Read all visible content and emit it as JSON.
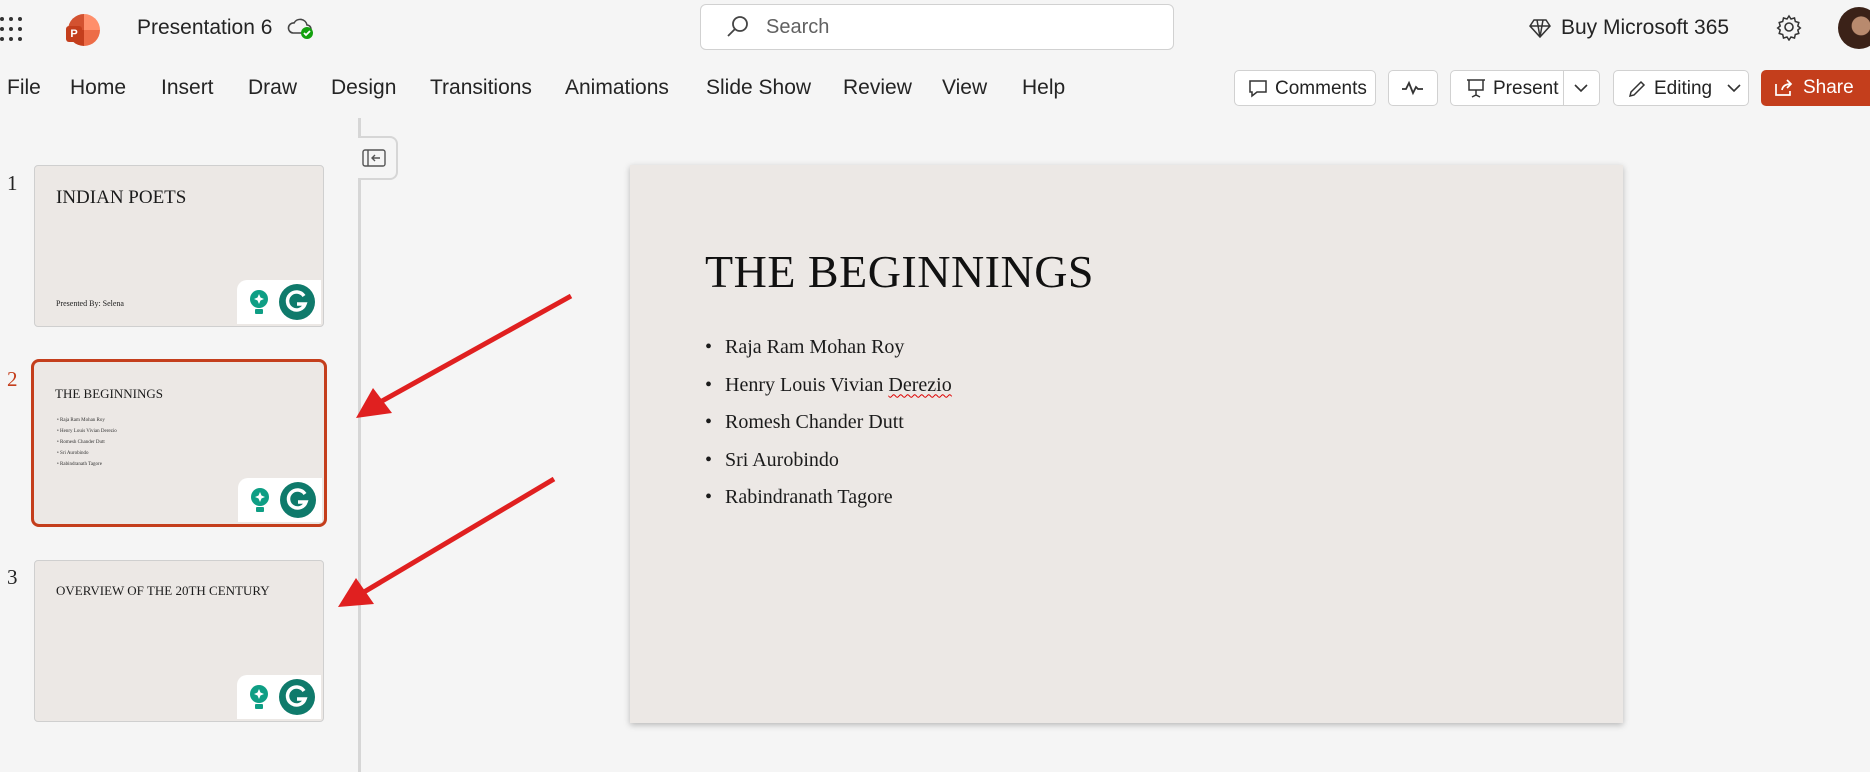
{
  "header": {
    "doc_title": "Presentation 6",
    "search_placeholder": "Search",
    "buy_label": "Buy Microsoft 365"
  },
  "ribbon": {
    "tabs": [
      "File",
      "Home",
      "Insert",
      "Draw",
      "Design",
      "Transitions",
      "Animations",
      "Slide Show",
      "Review",
      "View",
      "Help"
    ],
    "comments_label": "Comments",
    "present_label": "Present",
    "editing_label": "Editing",
    "share_label": "Share"
  },
  "thumbnails": [
    {
      "number": "1",
      "title": "INDIAN POETS",
      "subtitle": "Presented By: Selena"
    },
    {
      "number": "2",
      "title": "THE BEGINNINGS",
      "bullets": [
        "Raja Ram Mohan Roy",
        "Henry Louis Vivian Derezio",
        "Romesh Chander Dutt",
        "Sri Aurobindo",
        "Rabindranath Tagore"
      ]
    },
    {
      "number": "3",
      "title": "OVERVIEW OF THE 20TH CENTURY"
    }
  ],
  "slide": {
    "title": "THE BEGINNINGS",
    "bullets": [
      "Raja Ram Mohan Roy",
      "Henry Louis Vivian",
      "Derezio",
      "Romesh Chander Dutt",
      "Sri Aurobindo",
      "Rabindranath Tagore"
    ]
  },
  "colors": {
    "accent": "#c43e1c",
    "annotation_arrow": "#e02020",
    "grammarly": "#0f7a6b",
    "slide_bg": "#ece8e5"
  }
}
